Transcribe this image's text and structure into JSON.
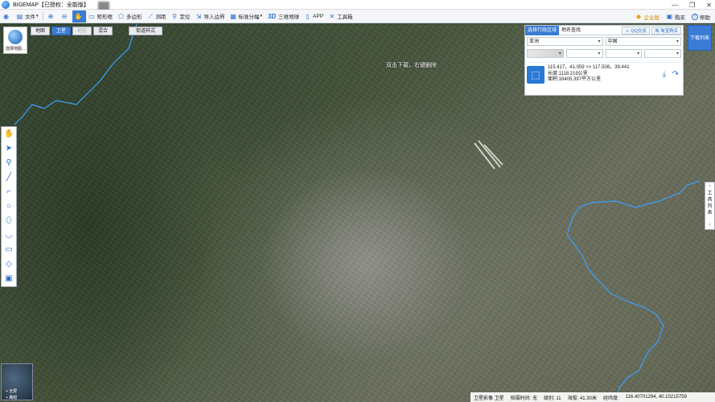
{
  "window": {
    "title": "BIGEMAP【已授权：全能版】",
    "controls": [
      "—",
      "❐",
      "✕"
    ]
  },
  "toolbar": {
    "items": [
      {
        "label": "文件",
        "icon": "folder-icon",
        "glyph": "▤"
      },
      {
        "label": "",
        "icon": "zoom-in-icon",
        "glyph": "⊕"
      },
      {
        "label": "",
        "icon": "zoom-out-icon",
        "glyph": "⊖"
      },
      {
        "label": "",
        "icon": "pan-hand-icon",
        "glyph": "✋"
      },
      {
        "label": "矩形框",
        "icon": "rectangle-select-icon",
        "glyph": "▭"
      },
      {
        "label": "多边形",
        "icon": "polygon-select-icon",
        "glyph": "⬠"
      },
      {
        "label": "测距",
        "icon": "ruler-icon",
        "glyph": "📏"
      },
      {
        "label": "定位",
        "icon": "locate-pin-icon",
        "glyph": "📍"
      },
      {
        "label": "导入边界",
        "icon": "import-boundary-icon",
        "glyph": "⇲"
      },
      {
        "label": "标准分幅",
        "icon": "grid-icon",
        "glyph": "▦"
      },
      {
        "label": "三维地球",
        "icon": "3d-icon",
        "glyph": "3D"
      },
      {
        "label": "APP",
        "icon": "app-phone-icon",
        "glyph": "▯"
      },
      {
        "label": "工具箱",
        "icon": "toolbox-icon",
        "glyph": "✕"
      }
    ],
    "right_items": [
      {
        "label": "企业版",
        "icon": "diamond-icon",
        "glyph": "◆"
      },
      {
        "label": "购买",
        "icon": "cart-icon",
        "glyph": "🛒"
      },
      {
        "label": "帮助",
        "icon": "help-icon",
        "glyph": "?"
      }
    ]
  },
  "logo_badge": {
    "label": "选择地图..."
  },
  "map_tabs": [
    {
      "label": "地图",
      "state": "normal"
    },
    {
      "label": "卫星",
      "state": "active"
    },
    {
      "label": "地形",
      "state": "disabled"
    },
    {
      "label": "混合",
      "state": "normal"
    }
  ],
  "map_style_button": "街道样式",
  "map_hint": "双击下载，右键删除",
  "left_tools": [
    {
      "icon": "hand-icon",
      "glyph": "✋"
    },
    {
      "icon": "pointer-icon",
      "glyph": "➤"
    },
    {
      "icon": "marker-icon",
      "glyph": "⬤"
    },
    {
      "icon": "line-icon",
      "glyph": "╱"
    },
    {
      "icon": "polyline-icon",
      "glyph": "⌐"
    },
    {
      "icon": "circle-icon",
      "glyph": "○"
    },
    {
      "icon": "ellipse-icon",
      "glyph": "⬭"
    },
    {
      "icon": "arc-icon",
      "glyph": "◡"
    },
    {
      "icon": "rectangle-icon",
      "glyph": "▭"
    },
    {
      "icon": "tag-icon",
      "glyph": "◇"
    },
    {
      "icon": "layers-icon",
      "glyph": "▣"
    }
  ],
  "panel": {
    "tabs": [
      {
        "label": "选择行政区域",
        "active": true
      },
      {
        "label": "地名查找",
        "active": false
      }
    ],
    "buttons": [
      {
        "label": "QQ交谈",
        "icon": "qq-icon",
        "glyph": "☺"
      },
      {
        "label": "淘宝购买",
        "icon": "taobao-icon",
        "glyph": "淘"
      }
    ],
    "continent": "亚洲",
    "country": "中国",
    "info": {
      "range": "115.417，41.059 >> 117.508，39.441",
      "length": "长度:1118.219公里",
      "area": "面积:16405.397平方公里"
    }
  },
  "download_button": "下载列表",
  "side_tab": {
    "chars": [
      "工",
      "具",
      "列",
      "表"
    ]
  },
  "minimap": {
    "line1": "+ 全屏",
    "line2": "+ 鹰眼"
  },
  "status": {
    "layer": "卫星影像 卫星",
    "capture_time": "拍摄时间: 无",
    "level": "级别: 11",
    "altitude": "海拔: 41.30米",
    "coords_label": "经纬度:",
    "coords": "116.40701294, 40.10215759"
  }
}
